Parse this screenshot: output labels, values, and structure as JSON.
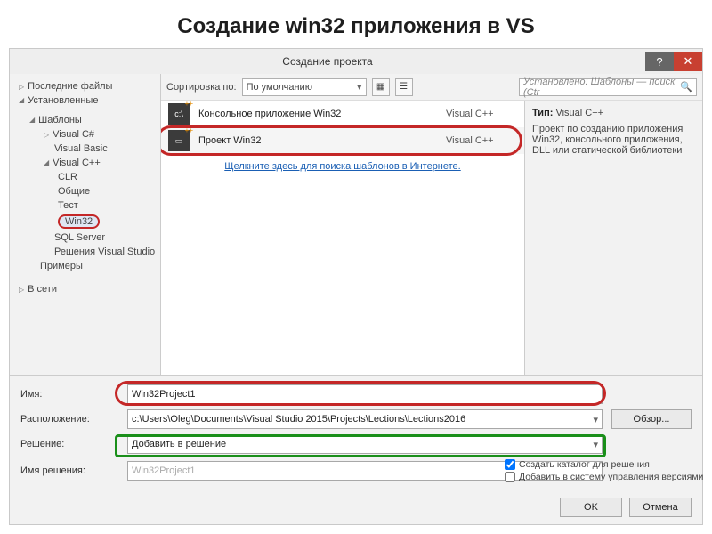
{
  "slide": {
    "title": "Создание win32 приложения в VS"
  },
  "dialog": {
    "title": "Создание проекта"
  },
  "sidebar": {
    "recent": "Последние файлы",
    "installed": "Установленные",
    "templates": "Шаблоны",
    "csharp": "Visual C#",
    "vb": "Visual Basic",
    "vcpp": "Visual C++",
    "clr": "CLR",
    "general": "Общие",
    "test": "Тест",
    "win32": "Win32",
    "sql": "SQL Server",
    "vssolutions": "Решения Visual Studio",
    "samples": "Примеры",
    "online": "В сети"
  },
  "toolbar": {
    "sort_label": "Сортировка по:",
    "sort_value": "По умолчанию",
    "search_placeholder": "Установлено: Шаблоны — поиск (Ctr"
  },
  "templates": [
    {
      "name": "Консольное приложение Win32",
      "lang": "Visual C++"
    },
    {
      "name": "Проект Win32",
      "lang": "Visual C++"
    }
  ],
  "center": {
    "online_link": "Щелкните здесь для поиска шаблонов в Интернете."
  },
  "detail": {
    "type_label": "Тип:",
    "type": "Visual C++",
    "description": "Проект по созданию приложения Win32, консольного приложения, DLL или статической библиотеки"
  },
  "form": {
    "name_label": "Имя:",
    "name_value": "Win32Project1",
    "location_label": "Расположение:",
    "location_value": "c:\\Users\\Oleg\\Documents\\Visual Studio 2015\\Projects\\Lections\\Lections2016",
    "browse": "Обзор...",
    "solution_label": "Решение:",
    "solution_value": "Добавить в решение",
    "solution_name_label": "Имя решения:",
    "solution_name_value": "Win32Project1",
    "cb_create_dir": "Создать каталог для решения",
    "cb_source_control": "Добавить в систему управления версиями"
  },
  "footer": {
    "ok": "OK",
    "cancel": "Отмена"
  }
}
